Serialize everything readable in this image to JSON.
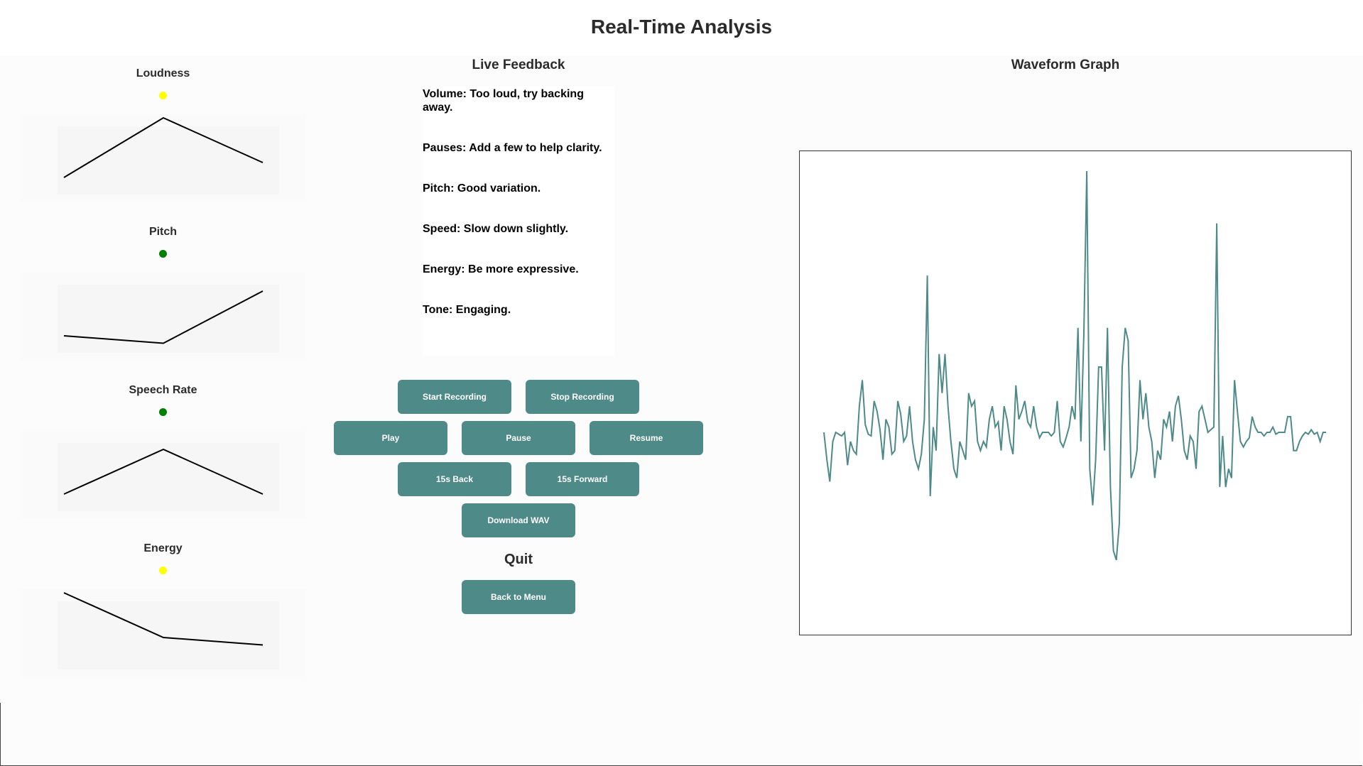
{
  "page": {
    "title": "Real-Time Analysis"
  },
  "colors": {
    "accent": "#4e8a88",
    "waveform": "#4e8a88",
    "status_yellow": "#ffff00",
    "status_green": "#008000"
  },
  "metrics": [
    {
      "label": "Loudness",
      "status_color": "#ffff00",
      "trend": [
        0.2,
        1.0,
        0.4
      ]
    },
    {
      "label": "Pitch",
      "status_color": "#008000",
      "trend": [
        0.2,
        0.1,
        0.8
      ]
    },
    {
      "label": "Speech Rate",
      "status_color": "#008000",
      "trend": [
        0.2,
        0.8,
        0.2
      ]
    },
    {
      "label": "Energy",
      "status_color": "#ffff00",
      "trend": [
        1.0,
        0.4,
        0.3
      ]
    }
  ],
  "feedback": {
    "title": "Live Feedback",
    "lines": [
      "Volume: Too loud, try backing away.",
      "Pauses: Add a few to help clarity.",
      "Pitch: Good variation.",
      "Speed: Slow down slightly.",
      "Energy: Be more expressive.",
      "Tone: Engaging."
    ]
  },
  "controls": {
    "start_recording": "Start Recording",
    "stop_recording": "Stop Recording",
    "play": "Play",
    "pause": "Pause",
    "resume": "Resume",
    "back_15": "15s Back",
    "forward_15": "15s Forward",
    "download_wav": "Download WAV",
    "quit_label": "Quit",
    "back_to_menu": "Back to Menu"
  },
  "waveform": {
    "title": "Waveform Graph",
    "samples": [
      0,
      -0.15,
      -0.27,
      -0.05,
      0,
      -0.01,
      -0.02,
      0,
      -0.18,
      -0.05,
      -0.1,
      -0.12,
      0.1,
      0.2,
      0.03,
      -0.01,
      -0.02,
      0.12,
      0.08,
      0.01,
      -0.15,
      0.05,
      0.02,
      -0.12,
      -0.1,
      0.12,
      0.07,
      -0.05,
      -0.02,
      0.1,
      -0.05,
      -0.15,
      -0.2,
      -0.12,
      0.05,
      0.6,
      -0.35,
      0.02,
      -0.1,
      0.3,
      0.15,
      0.3,
      0.1,
      -0.05,
      -0.2,
      -0.25,
      -0.05,
      -0.1,
      -0.15,
      0.15,
      0.1,
      0.12,
      -0.05,
      -0.1,
      -0.05,
      -0.08,
      0.05,
      0.1,
      0.02,
      0.04,
      -0.1,
      0.1,
      0.05,
      -0.05,
      -0.12,
      0.18,
      0.05,
      0.08,
      0.12,
      0.04,
      0.02,
      0.1,
      0.02,
      -0.03,
      0,
      0,
      0,
      -0.02,
      0,
      0.12,
      -0.05,
      -0.08,
      -0.03,
      0.02,
      0.1,
      0.05,
      0.4,
      -0.05,
      0.38,
      1.0,
      -0.2,
      -0.4,
      -0.15,
      0.25,
      0.25,
      -0.1,
      0.4,
      -0.3,
      -0.65,
      -0.7,
      -0.5,
      0.25,
      0.4,
      0.35,
      -0.25,
      -0.2,
      -0.1,
      0.2,
      0.05,
      0.15,
      0.02,
      -0.05,
      -0.25,
      -0.1,
      -0.15,
      0.05,
      0.02,
      0.08,
      -0.05,
      0.1,
      0.14,
      0.05,
      -0.1,
      -0.15,
      -0.02,
      -0.05,
      -0.2,
      0.08,
      0.1,
      0.05,
      0,
      0.01,
      0.02,
      0.8,
      -0.3,
      -0.02,
      -0.3,
      -0.2,
      -0.25,
      0.2,
      0.08,
      -0.05,
      -0.08,
      -0.05,
      -0.03,
      0.06,
      0.02,
      0,
      0,
      -0.02,
      0,
      0,
      0.02,
      -0.01,
      0,
      0,
      0,
      0.06,
      0.06,
      -0.1,
      -0.1,
      -0.05,
      -0.02,
      0,
      -0.01,
      0.01,
      -0.01,
      0,
      -0.05,
      0,
      0
    ]
  }
}
